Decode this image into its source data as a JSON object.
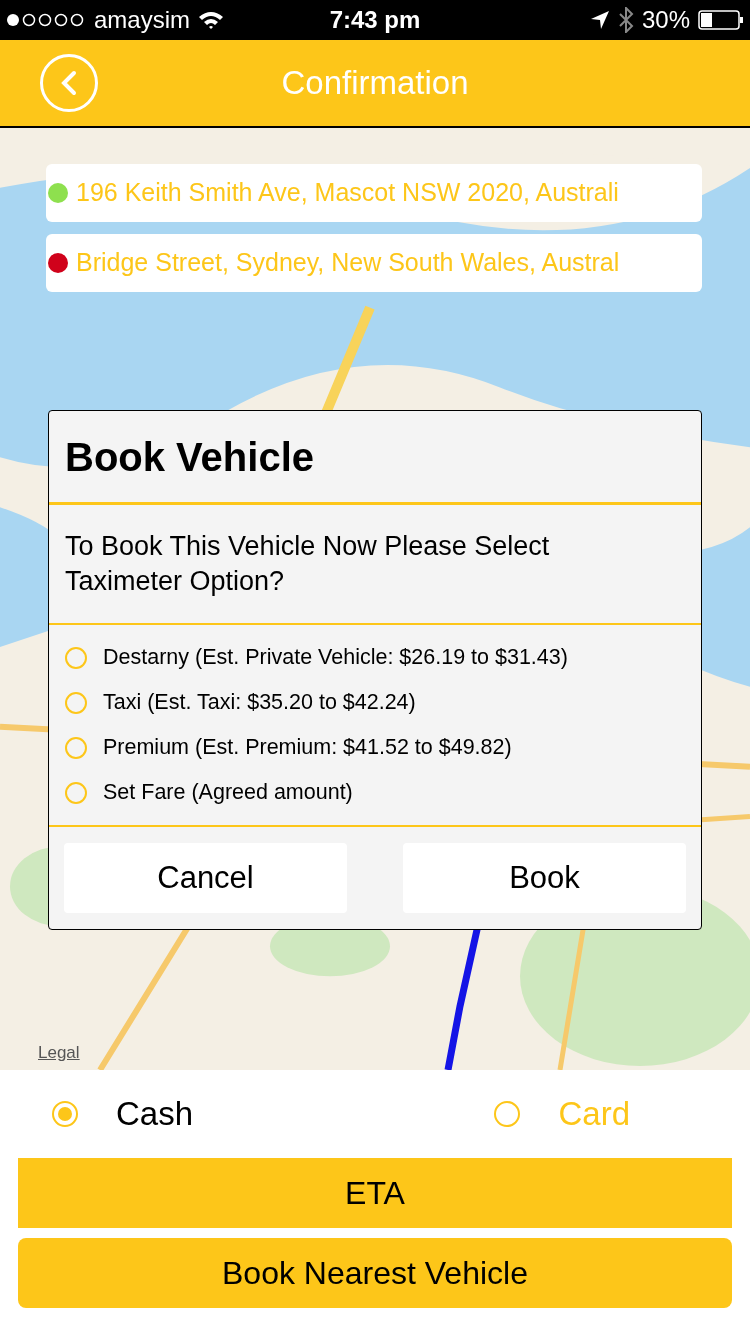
{
  "status_bar": {
    "carrier": "amaysim",
    "time": "7:43 pm",
    "battery": "30%"
  },
  "header": {
    "title": "Confirmation"
  },
  "map": {
    "legal": "Legal"
  },
  "addresses": [
    {
      "text": "196 Keith Smith Ave, Mascot NSW 2020, Australi",
      "color": "#8ee04e"
    },
    {
      "text": "Bridge Street, Sydney, New South Wales, Austral",
      "color": "#d0021b"
    }
  ],
  "dialog": {
    "title": "Book Vehicle",
    "message": "To Book This Vehicle Now Please Select Taximeter Option?",
    "options": [
      {
        "label": "Destarny (Est. Private Vehicle: $26.19 to $31.43)",
        "selected": false
      },
      {
        "label": "Taxi (Est. Taxi: $35.20 to $42.24)",
        "selected": false
      },
      {
        "label": "Premium (Est. Premium: $41.52 to $49.82)",
        "selected": false
      },
      {
        "label": "Set Fare (Agreed amount)",
        "selected": false
      }
    ],
    "buttons": [
      "Cancel",
      "Book"
    ]
  },
  "payment": [
    {
      "label": "Cash",
      "selected": true
    },
    {
      "label": "Card",
      "selected": false
    }
  ],
  "eta_button": "ETA",
  "book_button": "Book Nearest Vehicle"
}
